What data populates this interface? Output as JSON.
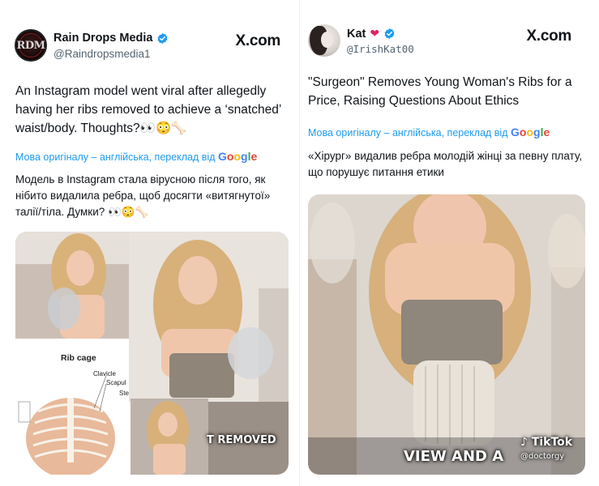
{
  "left_post": {
    "author_name": "Rain Drops Media",
    "author_handle": "@Raindropsmedia1",
    "avatar_text": "RDM",
    "brand": "X.com",
    "text": "An Instagram model went viral after allegedly having her ribs removed to achieve a ‘snatched’ waist/body. Thoughts?👀😳🦴",
    "translate_label": "Мова оригіналу – англійська, переклад від",
    "translate_provider": "Google",
    "translation": "Модель в Instagram стала вірусною після того, як нібито видалила ребра, щоб досягти «витягнутої» талії/тіла. Думки? 👀😳🦴",
    "media": {
      "diagram_title": "Rib cage",
      "diagram_labels": [
        "Clavicle",
        "Scapul",
        "Ste"
      ],
      "caption": "T REMOVED"
    }
  },
  "right_post": {
    "author_name": "Kat",
    "author_handle": "@IrishKat00",
    "brand": "X.com",
    "text": "\"Surgeon\" Removes Young Woman's Ribs for a Price, Raising Questions About Ethics",
    "translate_label": "Мова оригіналу – англійська, переклад від",
    "translate_provider": "Google",
    "translation": "«Хірург» видалив ребра молодій жінці за певну плату, що порушує питання етики",
    "media": {
      "caption": "VIEW AND A",
      "platform": "TikTok",
      "platform_handle": "@doctorgy"
    }
  },
  "colors": {
    "link_blue": "#1d9bf0",
    "verified_blue": "#1d9bf0",
    "text": "#0f1419",
    "secondary": "#536471"
  }
}
